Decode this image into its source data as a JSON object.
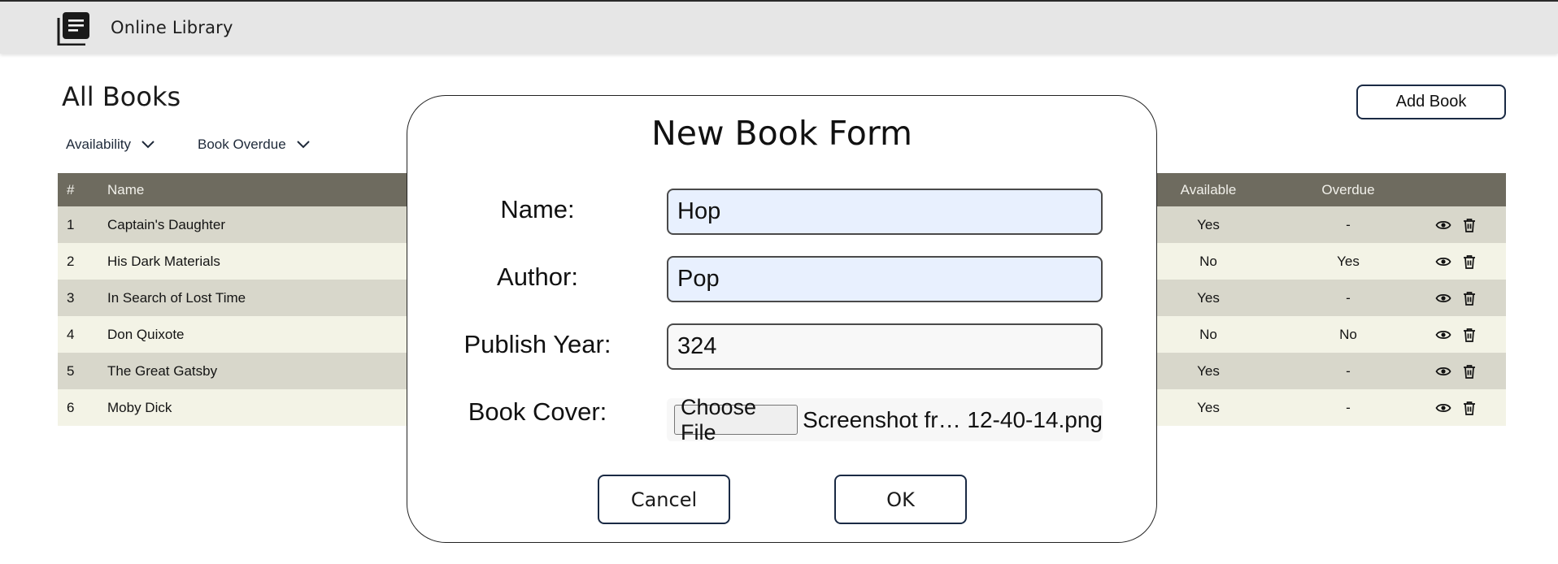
{
  "header": {
    "app_title": "Online Library",
    "logo_icon": "book-stack-icon"
  },
  "page": {
    "title": "All Books",
    "add_button": "Add Book",
    "filters": [
      {
        "label": "Availability",
        "icon": "chevron-down-icon"
      },
      {
        "label": "Book Overdue",
        "icon": "chevron-down-icon"
      }
    ]
  },
  "table": {
    "columns": {
      "num": "#",
      "name": "Name",
      "available": "Available",
      "overdue": "Overdue"
    },
    "rows": [
      {
        "num": "1",
        "name": "Captain's Daughter",
        "available": "Yes",
        "overdue": "-"
      },
      {
        "num": "2",
        "name": "His Dark Materials",
        "available": "No",
        "overdue": "Yes"
      },
      {
        "num": "3",
        "name": "In Search of Lost Time",
        "available": "Yes",
        "overdue": "-"
      },
      {
        "num": "4",
        "name": "Don Quixote",
        "available": "No",
        "overdue": "No"
      },
      {
        "num": "5",
        "name": "The Great Gatsby",
        "available": "Yes",
        "overdue": "-"
      },
      {
        "num": "6",
        "name": "Moby Dick",
        "available": "Yes",
        "overdue": "-"
      }
    ],
    "row_actions": [
      "eye-icon",
      "trash-icon"
    ]
  },
  "modal": {
    "title": "New Book Form",
    "fields": {
      "name": {
        "label": "Name:",
        "value": "Hop"
      },
      "author": {
        "label": "Author:",
        "value": "Pop"
      },
      "year": {
        "label": "Publish Year:",
        "value": "324"
      },
      "cover": {
        "label": "Book Cover:",
        "button": "Choose File",
        "file_name": "Screenshot fr… 12-40-14.png"
      }
    },
    "cancel_label": "Cancel",
    "ok_label": "OK"
  },
  "colors": {
    "header_bg": "#e6e6e6",
    "table_header_bg": "#6e6b5f",
    "row_odd_bg": "#d8d7cb",
    "row_even_bg": "#f3f3e6",
    "autofill_bg": "#e8f0fe",
    "button_border": "#1a2a44"
  }
}
